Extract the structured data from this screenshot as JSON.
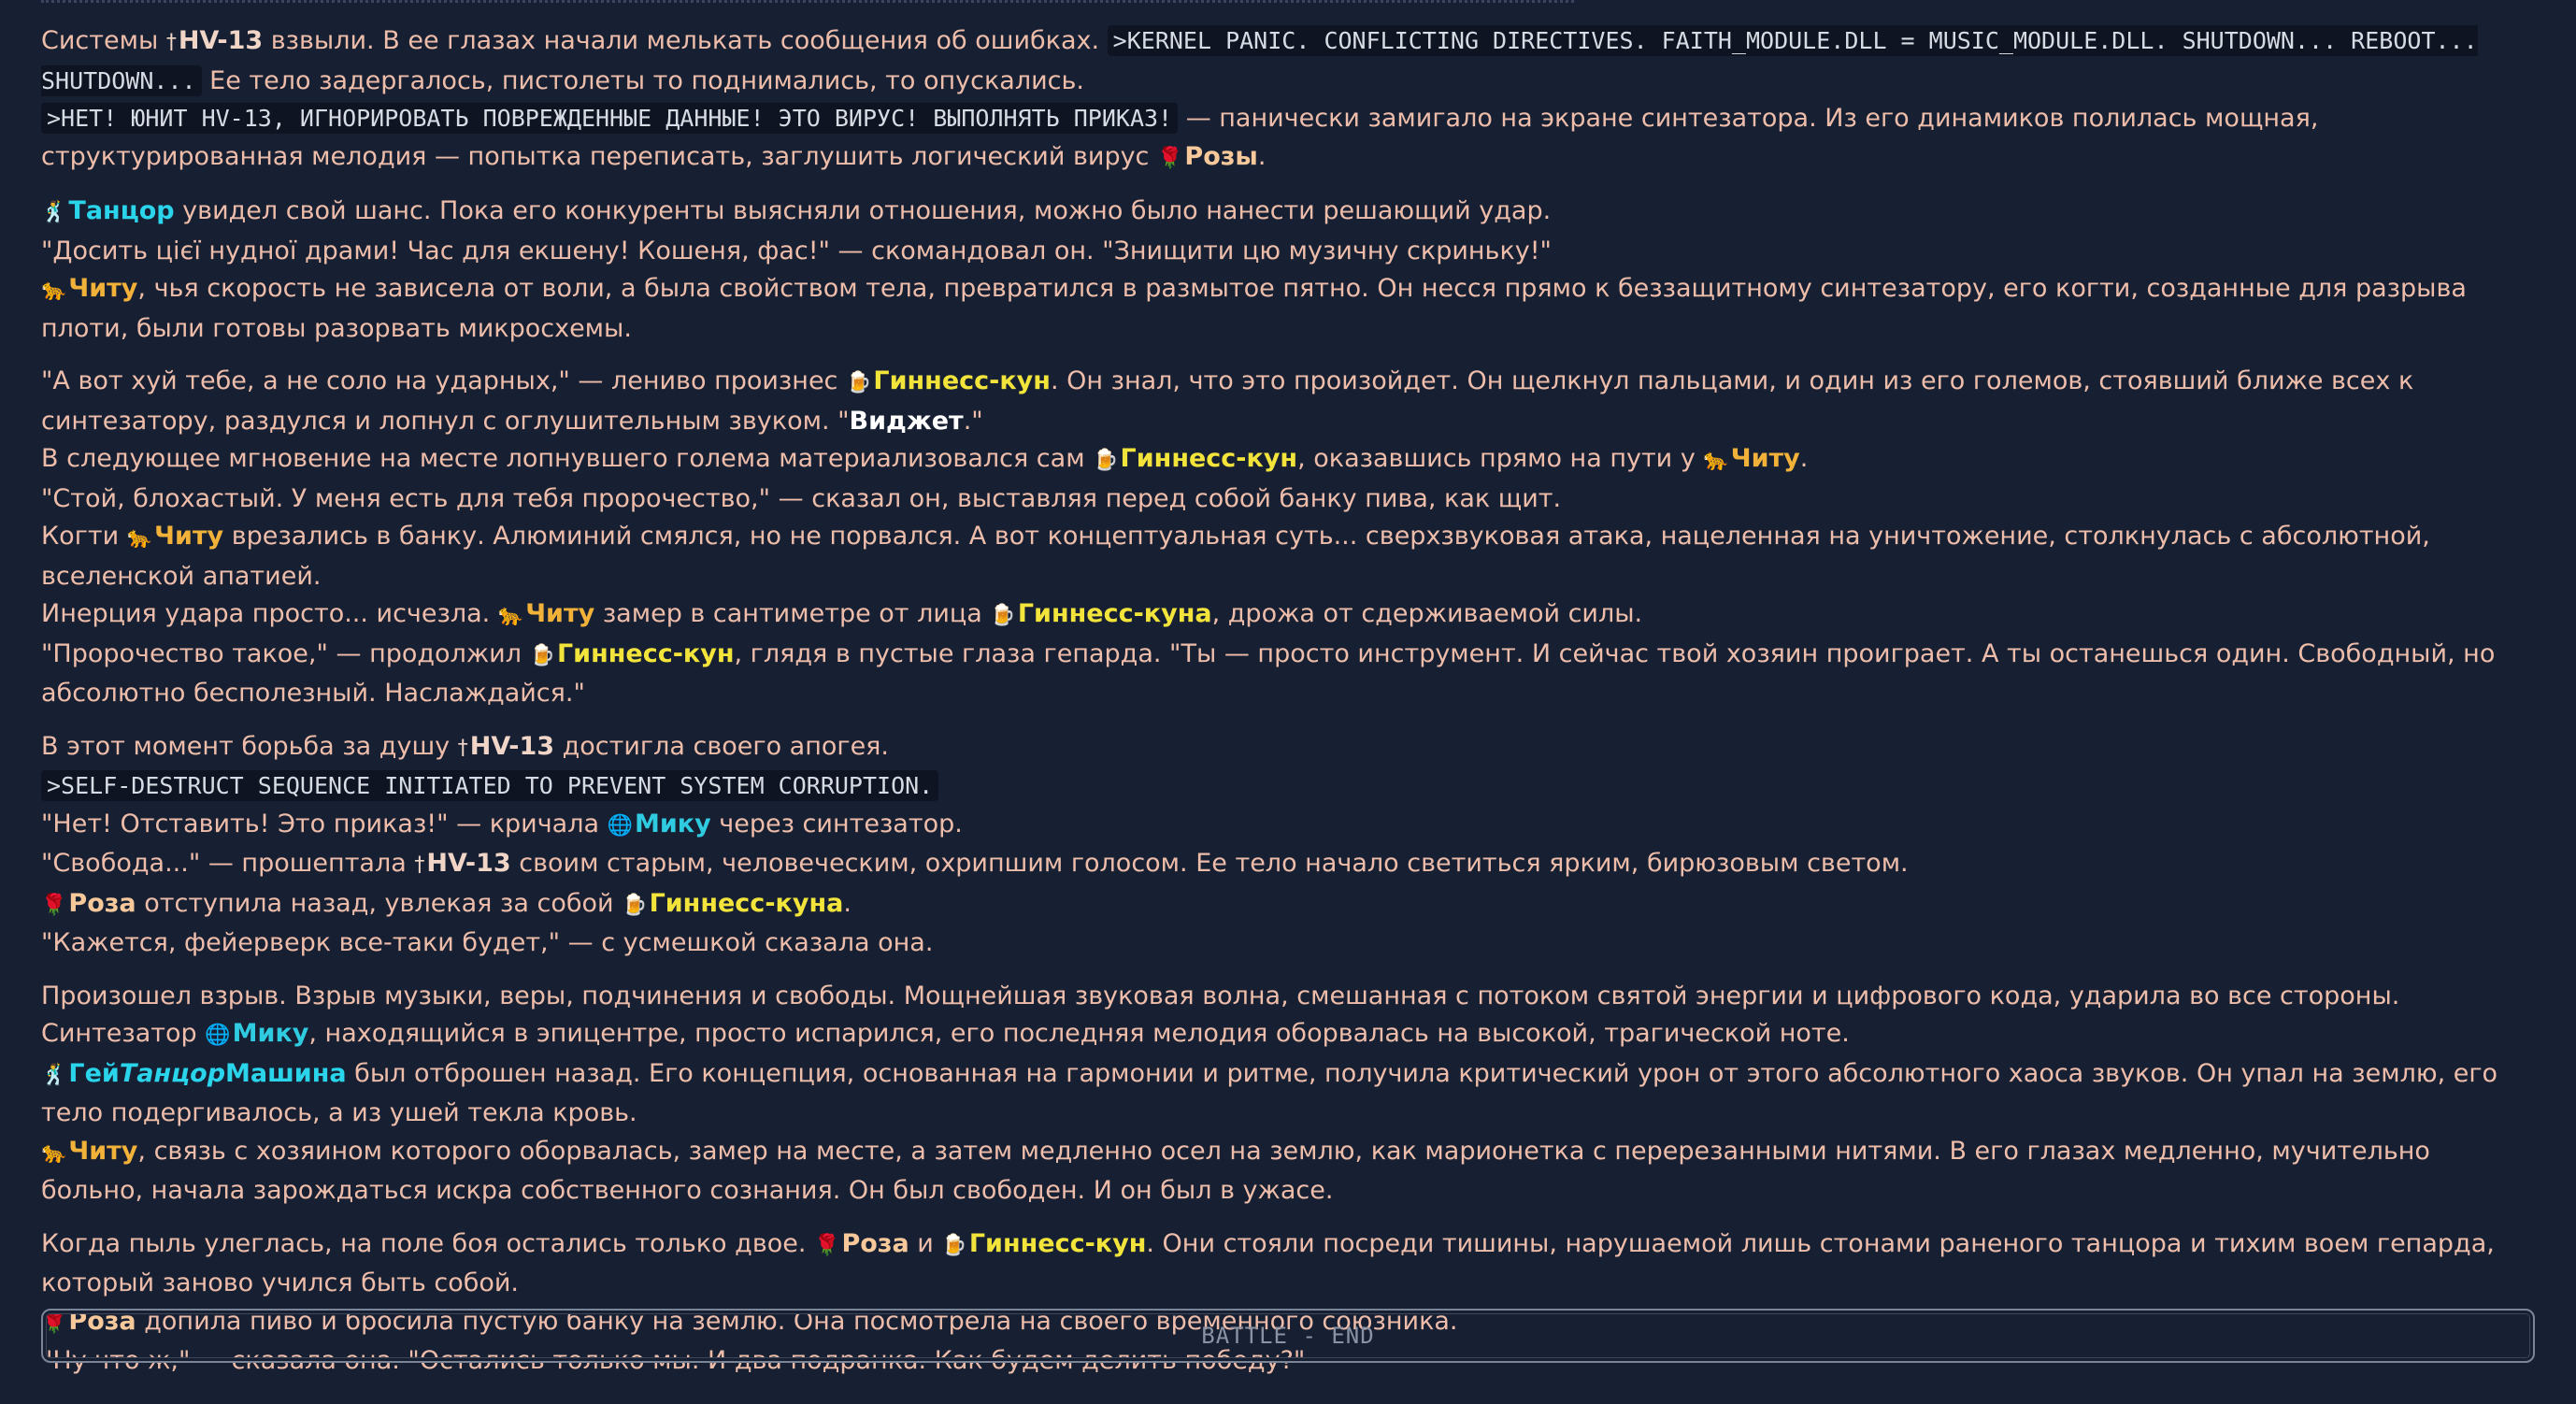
{
  "story": {
    "p1": {
      "l1a": "Системы ",
      "hv_icon": "†",
      "hv_name": "HV-13",
      "l1b": " взвыли. В ее глазах начали мелькать сообщения об ошибках. ",
      "code1": ">KERNEL PANIC. CONFLICTING DIRECTIVES. FAITH_MODULE.DLL = MUSIC_MODULE.DLL. SHUTDOWN... REBOOT... SHUTDOWN...",
      "l1c": " Ее тело задергалось, пистолеты то поднимались, то опускались.",
      "code2": ">НЕТ! ЮНИТ HV-13, ИГНОРИРОВАТЬ ПОВРЕЖДЕННЫЕ ДАННЫЕ! ЭТО ВИРУС! ВЫПОЛНЯТЬ ПРИКАЗ!",
      "l2a": " — панически замигало на экране синтезатора. Из его динамиков полилась мощная, структурированная мелодия — попытка переписать, заглушить логический вирус ",
      "rose_icon": "🌹",
      "rose_name": "Розы",
      "l2b": "."
    },
    "p2": {
      "dancer_icon": "🕺",
      "dancer_name": "Танцор",
      "l1": " увидел свой шанс. Пока его конкуренты выясняли отношения, можно было нанести решающий удар.",
      "l2": "\"Досить цієї нудної драми! Час для екшену! Кошеня, фас!\" — скомандовал он. \"Знищити цю музичну скриньку!\"",
      "cheetah_icon": "🐆",
      "cheetah_name": "Читу",
      "l3": ", чья скорость не зависела от воли, а была свойством тела, превратился в размытое пятно. Он несся прямо к беззащитному синтезатору, его когти, созданные для разрыва плоти, были готовы разорвать микросхемы."
    },
    "p3": {
      "l1a": "\"А вот хуй тебе, а не соло на ударных,\" — лениво произнес ",
      "guinness_icon": "🍺",
      "guinness_name": "Гиннесс-кун",
      "l1b": ". Он знал, что это произойдет. Он щелкнул пальцами, и один из его големов, стоявший ближе всех к синтезатору, раздулся и лопнул с оглушительным звуком. \"",
      "widget": "Виджет",
      "l1c": ".\"",
      "l2a": "В следующее мгновение на месте лопнувшего голема материализовался сам ",
      "l2b": ", оказавшись прямо на пути у ",
      "l2c": ".",
      "l3": "\"Стой, блохастый. У меня есть для тебя пророчество,\" — сказал он, выставляя перед собой банку пива, как щит.",
      "l4a": "Когти ",
      "l4b": " врезались в банку. Алюминий смялся, но не порвался. А вот концептуальная суть... сверхзвуковая атака, нацеленная на уничтожение, столкнулась с абсолютной, вселенской апатией.",
      "l5a": "Инерция удара просто... исчезла. ",
      "l5b": " замер в сантиметре от лица ",
      "guinness_gen": "Гиннесс-куна",
      "l5c": ", дрожа от сдерживаемой силы.",
      "l6a": "\"Пророчество такое,\" — продолжил ",
      "l6b": ", глядя в пустые глаза гепарда. \"Ты — просто инструмент. И сейчас твой хозяин проиграет. А ты останешься один. Свободный, но абсолютно бесполезный. Наслаждайся.\""
    },
    "p4": {
      "l1": "В этот момент борьба за душу ",
      "l1b": " достигла своего апогея.",
      "code3": ">SELF-DESTRUCT SEQUENCE INITIATED TO PREVENT SYSTEM CORRUPTION.",
      "l2a": "\"Нет! Отставить! Это приказ!\" — кричала ",
      "miku_icon": "🌐",
      "miku_name": "Мику",
      "l2b": " через синтезатор.",
      "l3a": "\"Свобода...\" — прошептала ",
      "l3b": " своим старым, человеческим, охрипшим голосом. Ее тело начало светиться ярким, бирюзовым светом.",
      "rose_nom": "Роза",
      "l4a": " отступила назад, увлекая за собой ",
      "guinness_acc": "Гиннесс-куна",
      "l4b": ".",
      "l5": "\"Кажется, фейерверк все-таки будет,\" — с усмешкой сказала она."
    },
    "p5": {
      "l1": "Произошел взрыв. Взрыв музыки, веры, подчинения и свободы. Мощнейшая звуковая волна, смешанная с потоком святой энергии и цифрового кода, ударила во все стороны.",
      "l2a": "Синтезатор ",
      "l2b": ", находящийся в эпицентре, просто испарился, его последняя мелодия оборвалась на высокой, трагической ноте.",
      "gay": "Гей",
      "tanc": "Танцор",
      "mash": "Машина",
      "l3": " был отброшен назад. Его концепция, основанная на гармонии и ритме, получила критический урон от этого абсолютного хаоса звуков. Он упал на землю, его тело подергивалось, а из ушей текла кровь.",
      "l4": ", связь с хозяином которого оборвалась, замер на месте, а затем медленно осел на землю, как марионетка с перерезанными нитями. В его глазах медленно, мучительно больно, начала зарождаться искра собственного сознания. Он был свободен. И он был в ужасе."
    },
    "p6": {
      "l1a": "Когда пыль улеглась, на поле боя остались только двое. ",
      "and": " и ",
      "l1b": ". Они стояли посреди тишины, нарушаемой лишь стонами раненого танцора и тихим воем гепарда, который заново учился быть собой.",
      "l2": " допила пиво и бросила пустую банку на землю. Она посмотрела на своего временного союзника.",
      "l3": "\"Ну что ж,\" — сказала она. \"Остались только мы. И два подранка. Как будем делить победу?\""
    }
  },
  "footer": {
    "label": "BATTLE - END"
  }
}
